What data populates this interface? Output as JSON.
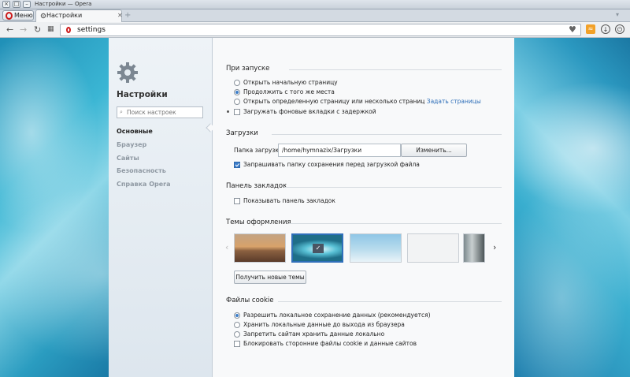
{
  "window": {
    "title": "Настройки — Opera"
  },
  "tabbar": {
    "menu_label": "Меню",
    "tab_label": "Настройки",
    "close_glyph": "✕",
    "new_tab_glyph": "+"
  },
  "addressbar": {
    "url": "settings"
  },
  "sidebar": {
    "title": "Настройки",
    "search_placeholder": "Поиск настроек",
    "items": [
      {
        "label": "Основные",
        "active": true
      },
      {
        "label": "Браузер",
        "active": false
      },
      {
        "label": "Сайты",
        "active": false
      },
      {
        "label": "Безопасность",
        "active": false
      },
      {
        "label": "Справка Opera",
        "active": false
      }
    ]
  },
  "startup": {
    "title": "При запуске",
    "options": [
      {
        "label": "Открыть начальную страницу",
        "selected": false
      },
      {
        "label": "Продолжить с того же места",
        "selected": true
      },
      {
        "label": "Открыть определенную страницу или несколько страниц",
        "selected": false,
        "link": "Задать страницы"
      }
    ],
    "delay_label": "Загружать фоновые вкладки с задержкой",
    "delay_checked": false
  },
  "downloads": {
    "title": "Загрузки",
    "folder_label": "Папка загрузки:",
    "folder_value": "/home/hymnazix/Загрузки",
    "change_button": "Изменить...",
    "ask_label": "Запрашивать папку сохранения перед загрузкой файла",
    "ask_checked": true
  },
  "bookmarks": {
    "title": "Панель закладок",
    "show_label": "Показывать панель закладок",
    "show_checked": false
  },
  "themes": {
    "title": "Темы оформления",
    "selected_index": 1,
    "get_button": "Получить новые темы"
  },
  "cookies": {
    "title": "Файлы cookie",
    "options": [
      {
        "label": "Разрешить локальное сохранение данных (рекомендуется)",
        "selected": true
      },
      {
        "label": "Хранить локальные данные до выхода из браузера",
        "selected": false
      },
      {
        "label": "Запретить сайтам хранить данные локально",
        "selected": false
      }
    ],
    "block_label": "Блокировать сторонние файлы cookie и данные сайтов",
    "block_checked": false
  },
  "colors": {
    "accent": "#3d7ec9",
    "link": "#2f6fb9",
    "opera_red": "#cc1b1b"
  }
}
